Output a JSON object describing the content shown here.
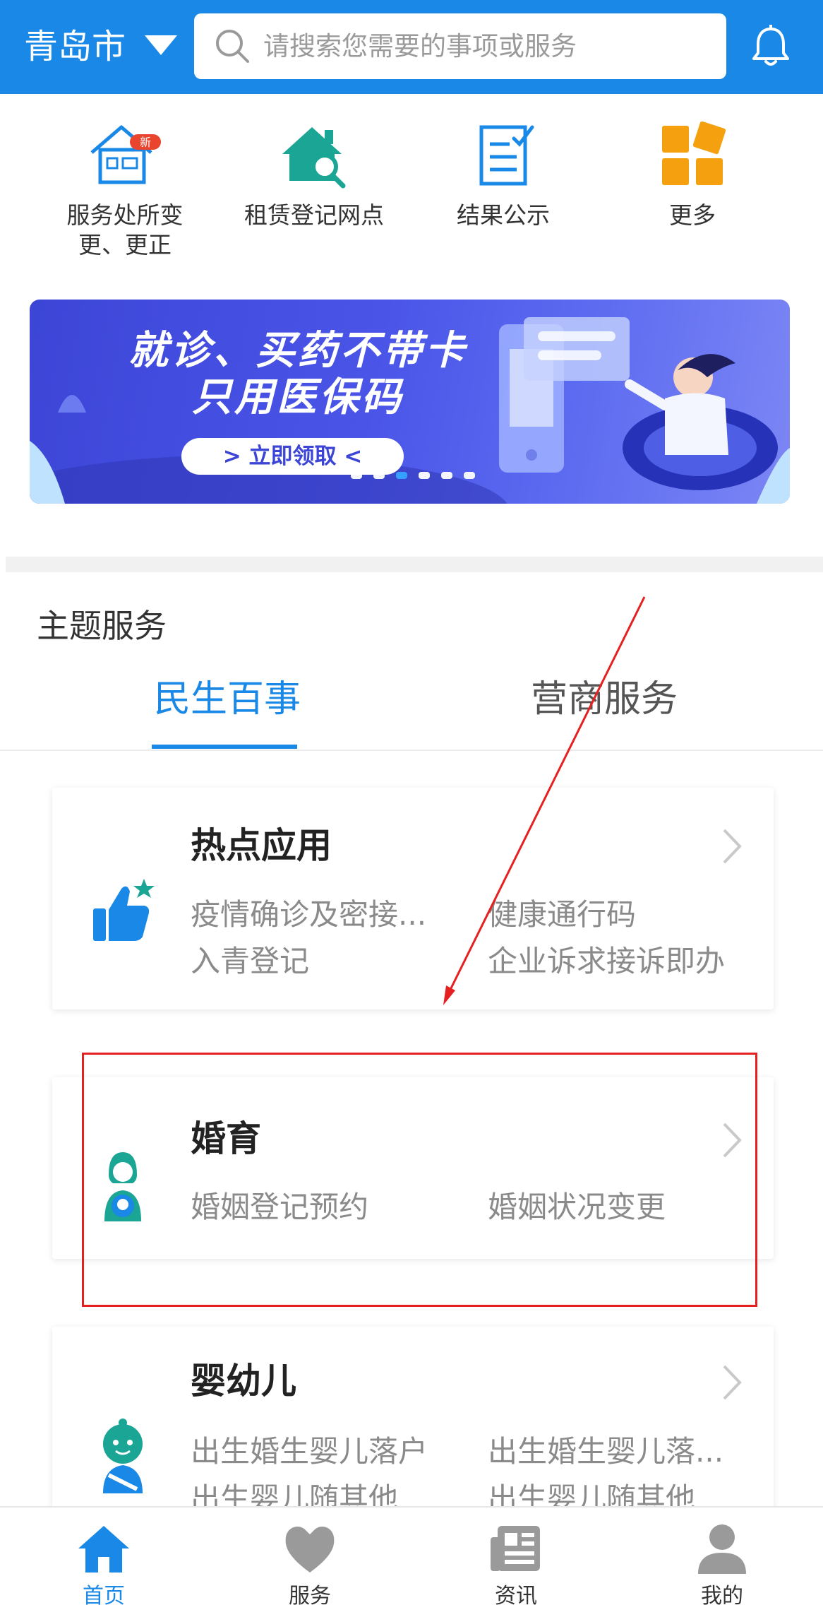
{
  "header": {
    "city": "青岛市",
    "search_placeholder": "请搜索您需要的事项或服务"
  },
  "quick_links": [
    {
      "label": "服务处所变更、更正",
      "icon": "house-new-icon",
      "badge": "新"
    },
    {
      "label": "租赁登记网点",
      "icon": "house-search-icon"
    },
    {
      "label": "结果公示",
      "icon": "document-check-icon"
    },
    {
      "label": "更多",
      "icon": "grid-more-icon"
    }
  ],
  "banner": {
    "title_line1": "就诊、买药不带卡",
    "title_line2": "只用医保码",
    "button": "> 立即领取 <",
    "dots": 6,
    "active_dot": 3
  },
  "section": {
    "title": "主题服务",
    "tabs": [
      {
        "label": "民生百事",
        "active": true
      },
      {
        "label": "营商服务",
        "active": false
      }
    ]
  },
  "cards": [
    {
      "title": "热点应用",
      "icon": "thumbs-up-icon",
      "items": [
        "疫情确诊及密接...",
        "健康通行码",
        "入青登记",
        "企业诉求接诉即办"
      ]
    },
    {
      "title": "婚育",
      "icon": "mother-baby-icon",
      "items": [
        "婚姻登记预约",
        "婚姻状况变更"
      ]
    },
    {
      "title": "婴幼儿",
      "icon": "baby-icon",
      "items": [
        "出生婚生婴儿落户",
        "出生婚生婴儿落...",
        "出生婴儿随其他",
        "出生婴儿随其他"
      ]
    }
  ],
  "bottom_nav": [
    {
      "label": "首页",
      "icon": "home-icon",
      "active": true
    },
    {
      "label": "服务",
      "icon": "heart-icon",
      "active": false
    },
    {
      "label": "资讯",
      "icon": "news-icon",
      "active": false
    },
    {
      "label": "我的",
      "icon": "user-icon",
      "active": false
    }
  ],
  "colors": {
    "primary": "#1a88e6",
    "annotation_red": "#e52020",
    "icon_teal": "#1aa594",
    "icon_orange": "#f5a00f"
  }
}
